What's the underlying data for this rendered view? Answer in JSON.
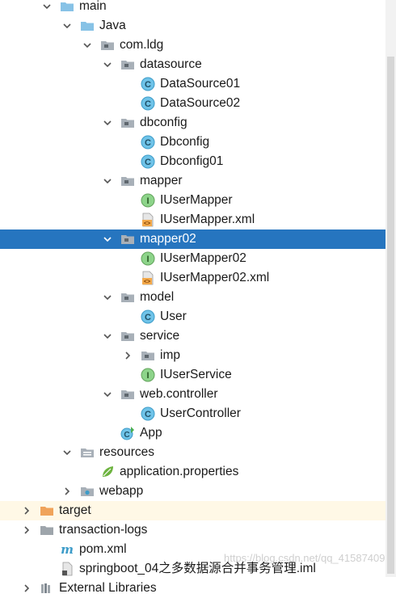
{
  "tree": [
    {
      "label": "main",
      "depth": 1,
      "icon": "folder-blue-icon",
      "arrow": "down"
    },
    {
      "label": "Java",
      "depth": 2,
      "icon": "folder-blue-icon",
      "arrow": "down"
    },
    {
      "label": "com.ldg",
      "depth": 3,
      "icon": "package-icon",
      "arrow": "down"
    },
    {
      "label": "datasource",
      "depth": 4,
      "icon": "package-icon",
      "arrow": "down"
    },
    {
      "label": "DataSource01",
      "depth": 5,
      "icon": "class-icon"
    },
    {
      "label": "DataSource02",
      "depth": 5,
      "icon": "class-icon"
    },
    {
      "label": "dbconfig",
      "depth": 4,
      "icon": "package-icon",
      "arrow": "down"
    },
    {
      "label": "Dbconfig",
      "depth": 5,
      "icon": "class-icon"
    },
    {
      "label": "Dbconfig01",
      "depth": 5,
      "icon": "class-icon"
    },
    {
      "label": "mapper",
      "depth": 4,
      "icon": "package-icon",
      "arrow": "down"
    },
    {
      "label": "IUserMapper",
      "depth": 5,
      "icon": "interface-icon"
    },
    {
      "label": "IUserMapper.xml",
      "depth": 5,
      "icon": "xml-file-icon"
    },
    {
      "label": "mapper02",
      "depth": 4,
      "icon": "package-icon",
      "arrow": "down",
      "selected": true
    },
    {
      "label": "IUserMapper02",
      "depth": 5,
      "icon": "interface-icon"
    },
    {
      "label": "IUserMapper02.xml",
      "depth": 5,
      "icon": "xml-file-icon"
    },
    {
      "label": "model",
      "depth": 4,
      "icon": "package-icon",
      "arrow": "down"
    },
    {
      "label": "User",
      "depth": 5,
      "icon": "class-icon"
    },
    {
      "label": "service",
      "depth": 4,
      "icon": "package-icon",
      "arrow": "down"
    },
    {
      "label": "imp",
      "depth": 5,
      "icon": "package-icon",
      "arrow": "right"
    },
    {
      "label": "IUserService",
      "depth": 5,
      "icon": "interface-icon"
    },
    {
      "label": "web.controller",
      "depth": 4,
      "icon": "package-icon",
      "arrow": "down"
    },
    {
      "label": "UserController",
      "depth": 5,
      "icon": "class-icon"
    },
    {
      "label": "App",
      "depth": 4,
      "icon": "spring-app-class-icon"
    },
    {
      "label": "resources",
      "depth": 2,
      "icon": "resources-folder-icon",
      "arrow": "down"
    },
    {
      "label": "application.properties",
      "depth": 3,
      "icon": "spring-leaf-icon"
    },
    {
      "label": "webapp",
      "depth": 2,
      "icon": "web-folder-icon",
      "arrow": "right"
    },
    {
      "label": "target",
      "depth": 0,
      "icon": "folder-orange-icon",
      "arrow": "right",
      "excluded": true
    },
    {
      "label": "transaction-logs",
      "depth": 0,
      "icon": "folder-gray-icon",
      "arrow": "right"
    },
    {
      "label": "pom.xml",
      "depth": 1,
      "icon": "maven-icon"
    },
    {
      "label": "springboot_04之多数据源合并事务管理.iml",
      "depth": 1,
      "icon": "iml-file-icon"
    },
    {
      "label": "External Libraries",
      "depth": 0,
      "icon": "library-icon",
      "arrow": "right"
    }
  ],
  "watermark": "https://blog.csdn.net/qq_41587409",
  "colors": {
    "selection": "#2675bf",
    "excluded_background": "#fff8e6",
    "class_icon": "#3d9cc9",
    "interface_icon": "#63a35c",
    "folder_blue": "#87c2e6",
    "folder_gray": "#9ea5ab",
    "folder_orange": "#f0a35a"
  }
}
